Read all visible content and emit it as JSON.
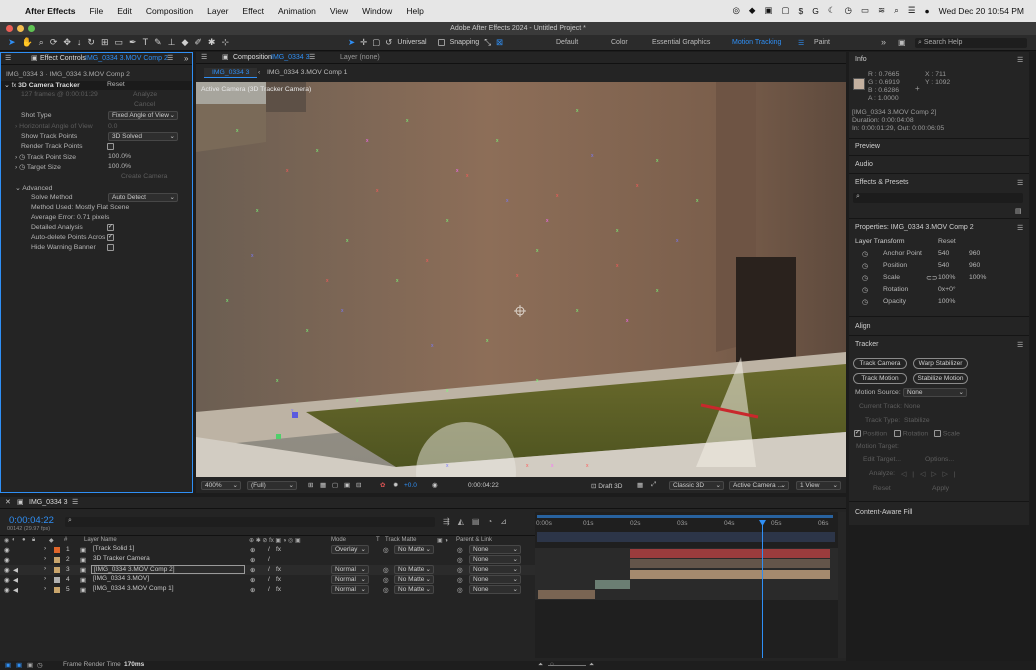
{
  "menubar": {
    "app": "After Effects",
    "items": [
      "File",
      "Edit",
      "Composition",
      "Layer",
      "Effect",
      "Animation",
      "View",
      "Window",
      "Help"
    ],
    "clock": "Wed Dec 20  10:54 PM"
  },
  "window_title": "Adobe After Effects 2024 - Untitled Project *",
  "toolbar": {
    "universal": "Universal",
    "snapping": "Snapping",
    "workspaces": [
      "Default",
      "Color",
      "Essential Graphics",
      "Motion Tracking",
      "Paint"
    ],
    "active_workspace": "Motion Tracking",
    "search_placeholder": "Search Help"
  },
  "effect_controls": {
    "tab_prefix": "Effect Controls",
    "tab_target": "IMG_0334 3.MOV Comp 2",
    "path": "IMG_0334 3 · IMG_0334 3.MOV Comp 2",
    "fx_name": "3D Camera Tracker",
    "reset": "Reset",
    "frames_info": "127 frames @ 0:00:01:29",
    "analyze": "Analyze",
    "cancel": "Cancel",
    "shot_type_label": "Shot Type",
    "shot_type_value": "Fixed Angle of View",
    "horizontal_aov": "Horizontal Angle of View",
    "horizontal_aov_value": "0.0",
    "show_track_points_label": "Show Track Points",
    "show_track_points_value": "3D Solved",
    "render_track_points": "Render Track Points",
    "track_point_size_label": "Track Point Size",
    "track_point_size_value": "100.0%",
    "target_size_label": "Target Size",
    "target_size_value": "100.0%",
    "create_camera": "Create Camera",
    "advanced": "Advanced",
    "solve_method_label": "Solve Method",
    "solve_method_value": "Auto Detect",
    "method_used": "Method Used: Mostly Flat Scene",
    "average_error": "Average Error: 0.71 pixels",
    "detailed_analysis": "Detailed Analysis",
    "auto_delete": "Auto-delete Points Acros",
    "hide_warning": "Hide Warning Banner"
  },
  "composition": {
    "tab_prefix": "Composition",
    "tab_name": "IMG_0334 3",
    "layer_tab": "Layer (none)",
    "breadcrumb_1": "IMG_0334 3",
    "breadcrumb_2": "IMG_0334 3.MOV Comp 1",
    "viewer_label": "Active Camera (3D Tracker Camera)",
    "zoom": "400%",
    "resolution": "(Full)",
    "exposure": "+0.0",
    "timecode": "0:00:04:22",
    "renderer_label": "Draft 3D",
    "renderer": "Classic 3D",
    "camera": "Active Camera ...",
    "views": "1 View"
  },
  "info": {
    "title": "Info",
    "r": "R : 0.7665",
    "g": "G : 0.6919",
    "b": "B : 0.6286",
    "a": "A : 1.0000",
    "x": "X : 711",
    "y": "Y : 1092",
    "swatch_color": "#c4b1a0",
    "layer": "[IMG_0334 3.MOV Comp 2]",
    "duration": "Duration: 0:00:04:08",
    "in_out": "In: 0:00:01:29, Out: 0:00:06:05"
  },
  "right_panels": {
    "preview": "Preview",
    "audio": "Audio",
    "effects_presets": "Effects & Presets",
    "properties_title": "Properties: IMG_0334 3.MOV Comp 2",
    "layer_transform": "Layer Transform",
    "reset": "Reset",
    "props": [
      {
        "name": "Anchor Point",
        "v1": "540",
        "v2": "960"
      },
      {
        "name": "Position",
        "v1": "540",
        "v2": "960"
      },
      {
        "name": "Scale",
        "v1": "100%",
        "v2": "100%"
      },
      {
        "name": "Rotation",
        "v1": "0x+0°",
        "v2": ""
      },
      {
        "name": "Opacity",
        "v1": "100%",
        "v2": ""
      }
    ],
    "align": "Align",
    "tracker": "Tracker",
    "track_camera": "Track Camera",
    "warp_stabilizer": "Warp Stabilizer",
    "track_motion": "Track Motion",
    "stabilize_motion": "Stabilize Motion",
    "motion_source_label": "Motion Source:",
    "motion_source_value": "None",
    "current_track": "Current Track:",
    "current_track_value": "None",
    "track_type": "Track Type:",
    "track_type_value": "Stabilize",
    "position": "Position",
    "rotation": "Rotation",
    "scale": "Scale",
    "motion_target": "Motion Target:",
    "edit_target": "Edit Target...",
    "options": "Options...",
    "analyze": "Analyze:",
    "reset_btn": "Reset",
    "apply": "Apply",
    "content_aware": "Content-Aware Fill"
  },
  "timeline": {
    "tab": "IMG_0334 3",
    "timecode": "0:00:04:22",
    "frame_info": "00142 (29.97 fps)",
    "col_layer_name": "Layer Name",
    "col_mode": "Mode",
    "col_t": "T",
    "col_track_matte": "Track Matte",
    "col_parent": "Parent & Link",
    "layers": [
      {
        "num": "1",
        "name": "[Track Solid 1]",
        "mode": "Overlay",
        "matte": "No Matte",
        "parent": "None",
        "color": "#e0662a"
      },
      {
        "num": "2",
        "name": "3D Tracker Camera",
        "mode": "",
        "matte": "",
        "parent": "None",
        "color": "#c9a56c"
      },
      {
        "num": "3",
        "name": "[IMG_0334 3.MOV Comp 2]",
        "mode": "Normal",
        "matte": "No Matte",
        "parent": "None",
        "color": "#c9a56c"
      },
      {
        "num": "4",
        "name": "[IMG_0334 3.MOV]",
        "mode": "Normal",
        "matte": "No Matte",
        "parent": "None",
        "color": "#b0b0b0"
      },
      {
        "num": "5",
        "name": "[IMG_0334 3.MOV Comp 1]",
        "mode": "Normal",
        "matte": "No Matte",
        "parent": "None",
        "color": "#c9a56c"
      }
    ],
    "ruler": [
      "0:00s",
      "01s",
      "02s",
      "03s",
      "04s",
      "05s",
      "06s"
    ],
    "footer_label": "Frame Render Time",
    "render_time": "170ms"
  }
}
